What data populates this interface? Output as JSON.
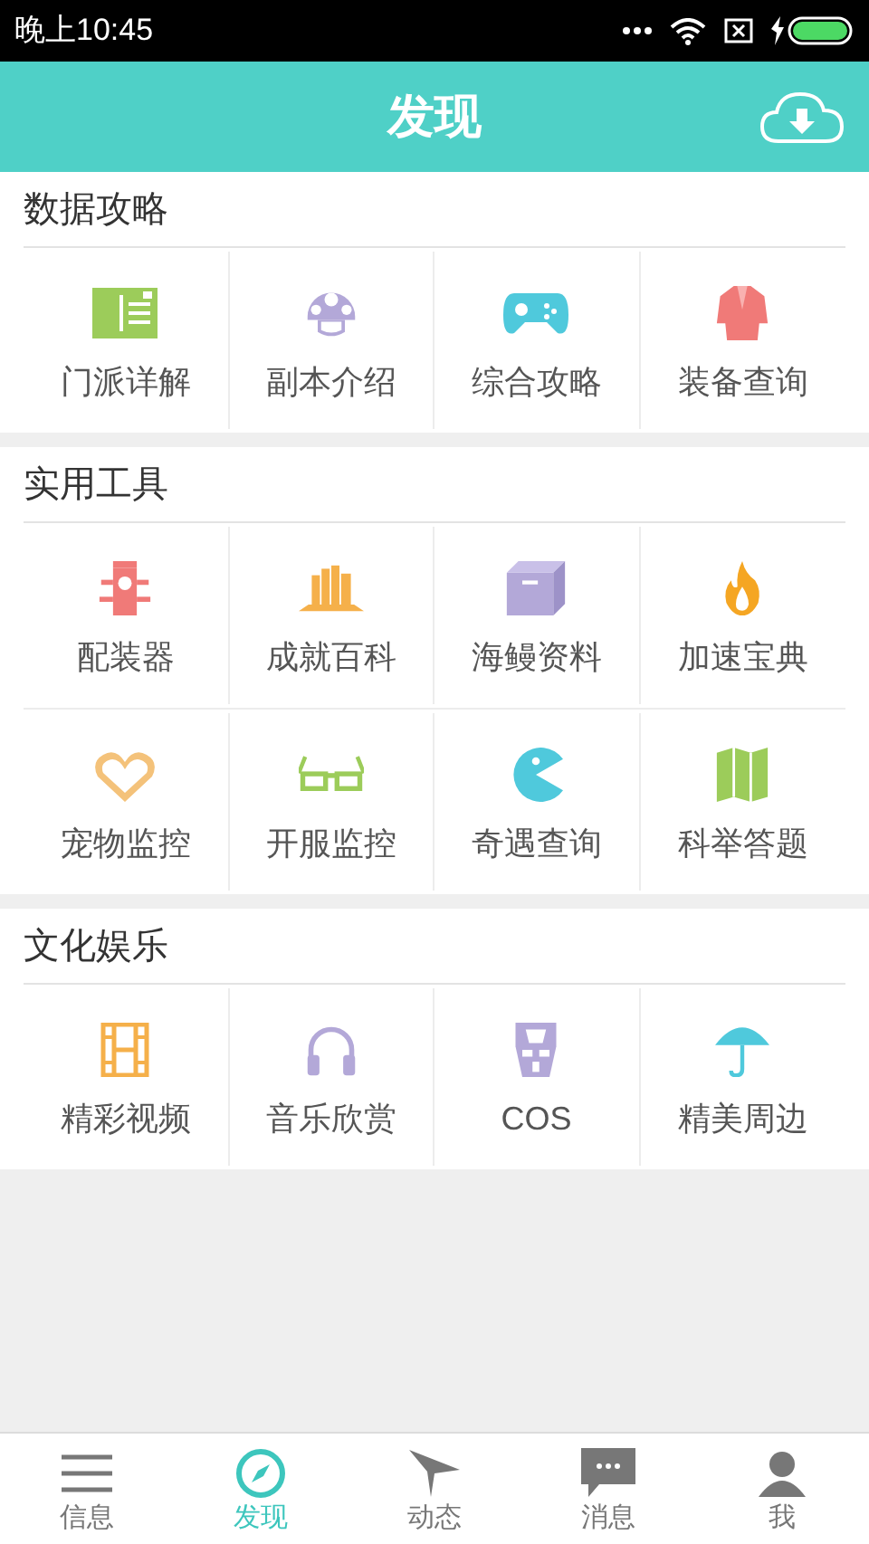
{
  "status_bar": {
    "time": "晚上10:45"
  },
  "header": {
    "title": "发现"
  },
  "sections": [
    {
      "title": "数据攻略",
      "items": [
        {
          "label": "门派详解"
        },
        {
          "label": "副本介绍"
        },
        {
          "label": "综合攻略"
        },
        {
          "label": "装备查询"
        }
      ]
    },
    {
      "title": "实用工具",
      "items": [
        {
          "label": "配装器"
        },
        {
          "label": "成就百科"
        },
        {
          "label": "海鳗资料"
        },
        {
          "label": "加速宝典"
        },
        {
          "label": "宠物监控"
        },
        {
          "label": "开服监控"
        },
        {
          "label": "奇遇查询"
        },
        {
          "label": "科举答题"
        }
      ]
    },
    {
      "title": "文化娱乐",
      "items": [
        {
          "label": "精彩视频"
        },
        {
          "label": "音乐欣赏"
        },
        {
          "label": "COS"
        },
        {
          "label": "精美周边"
        }
      ]
    }
  ],
  "bottom_nav": [
    {
      "label": "信息",
      "selected": false
    },
    {
      "label": "发现",
      "selected": true
    },
    {
      "label": "动态",
      "selected": false
    },
    {
      "label": "消息",
      "selected": false
    },
    {
      "label": "我",
      "selected": false
    }
  ]
}
